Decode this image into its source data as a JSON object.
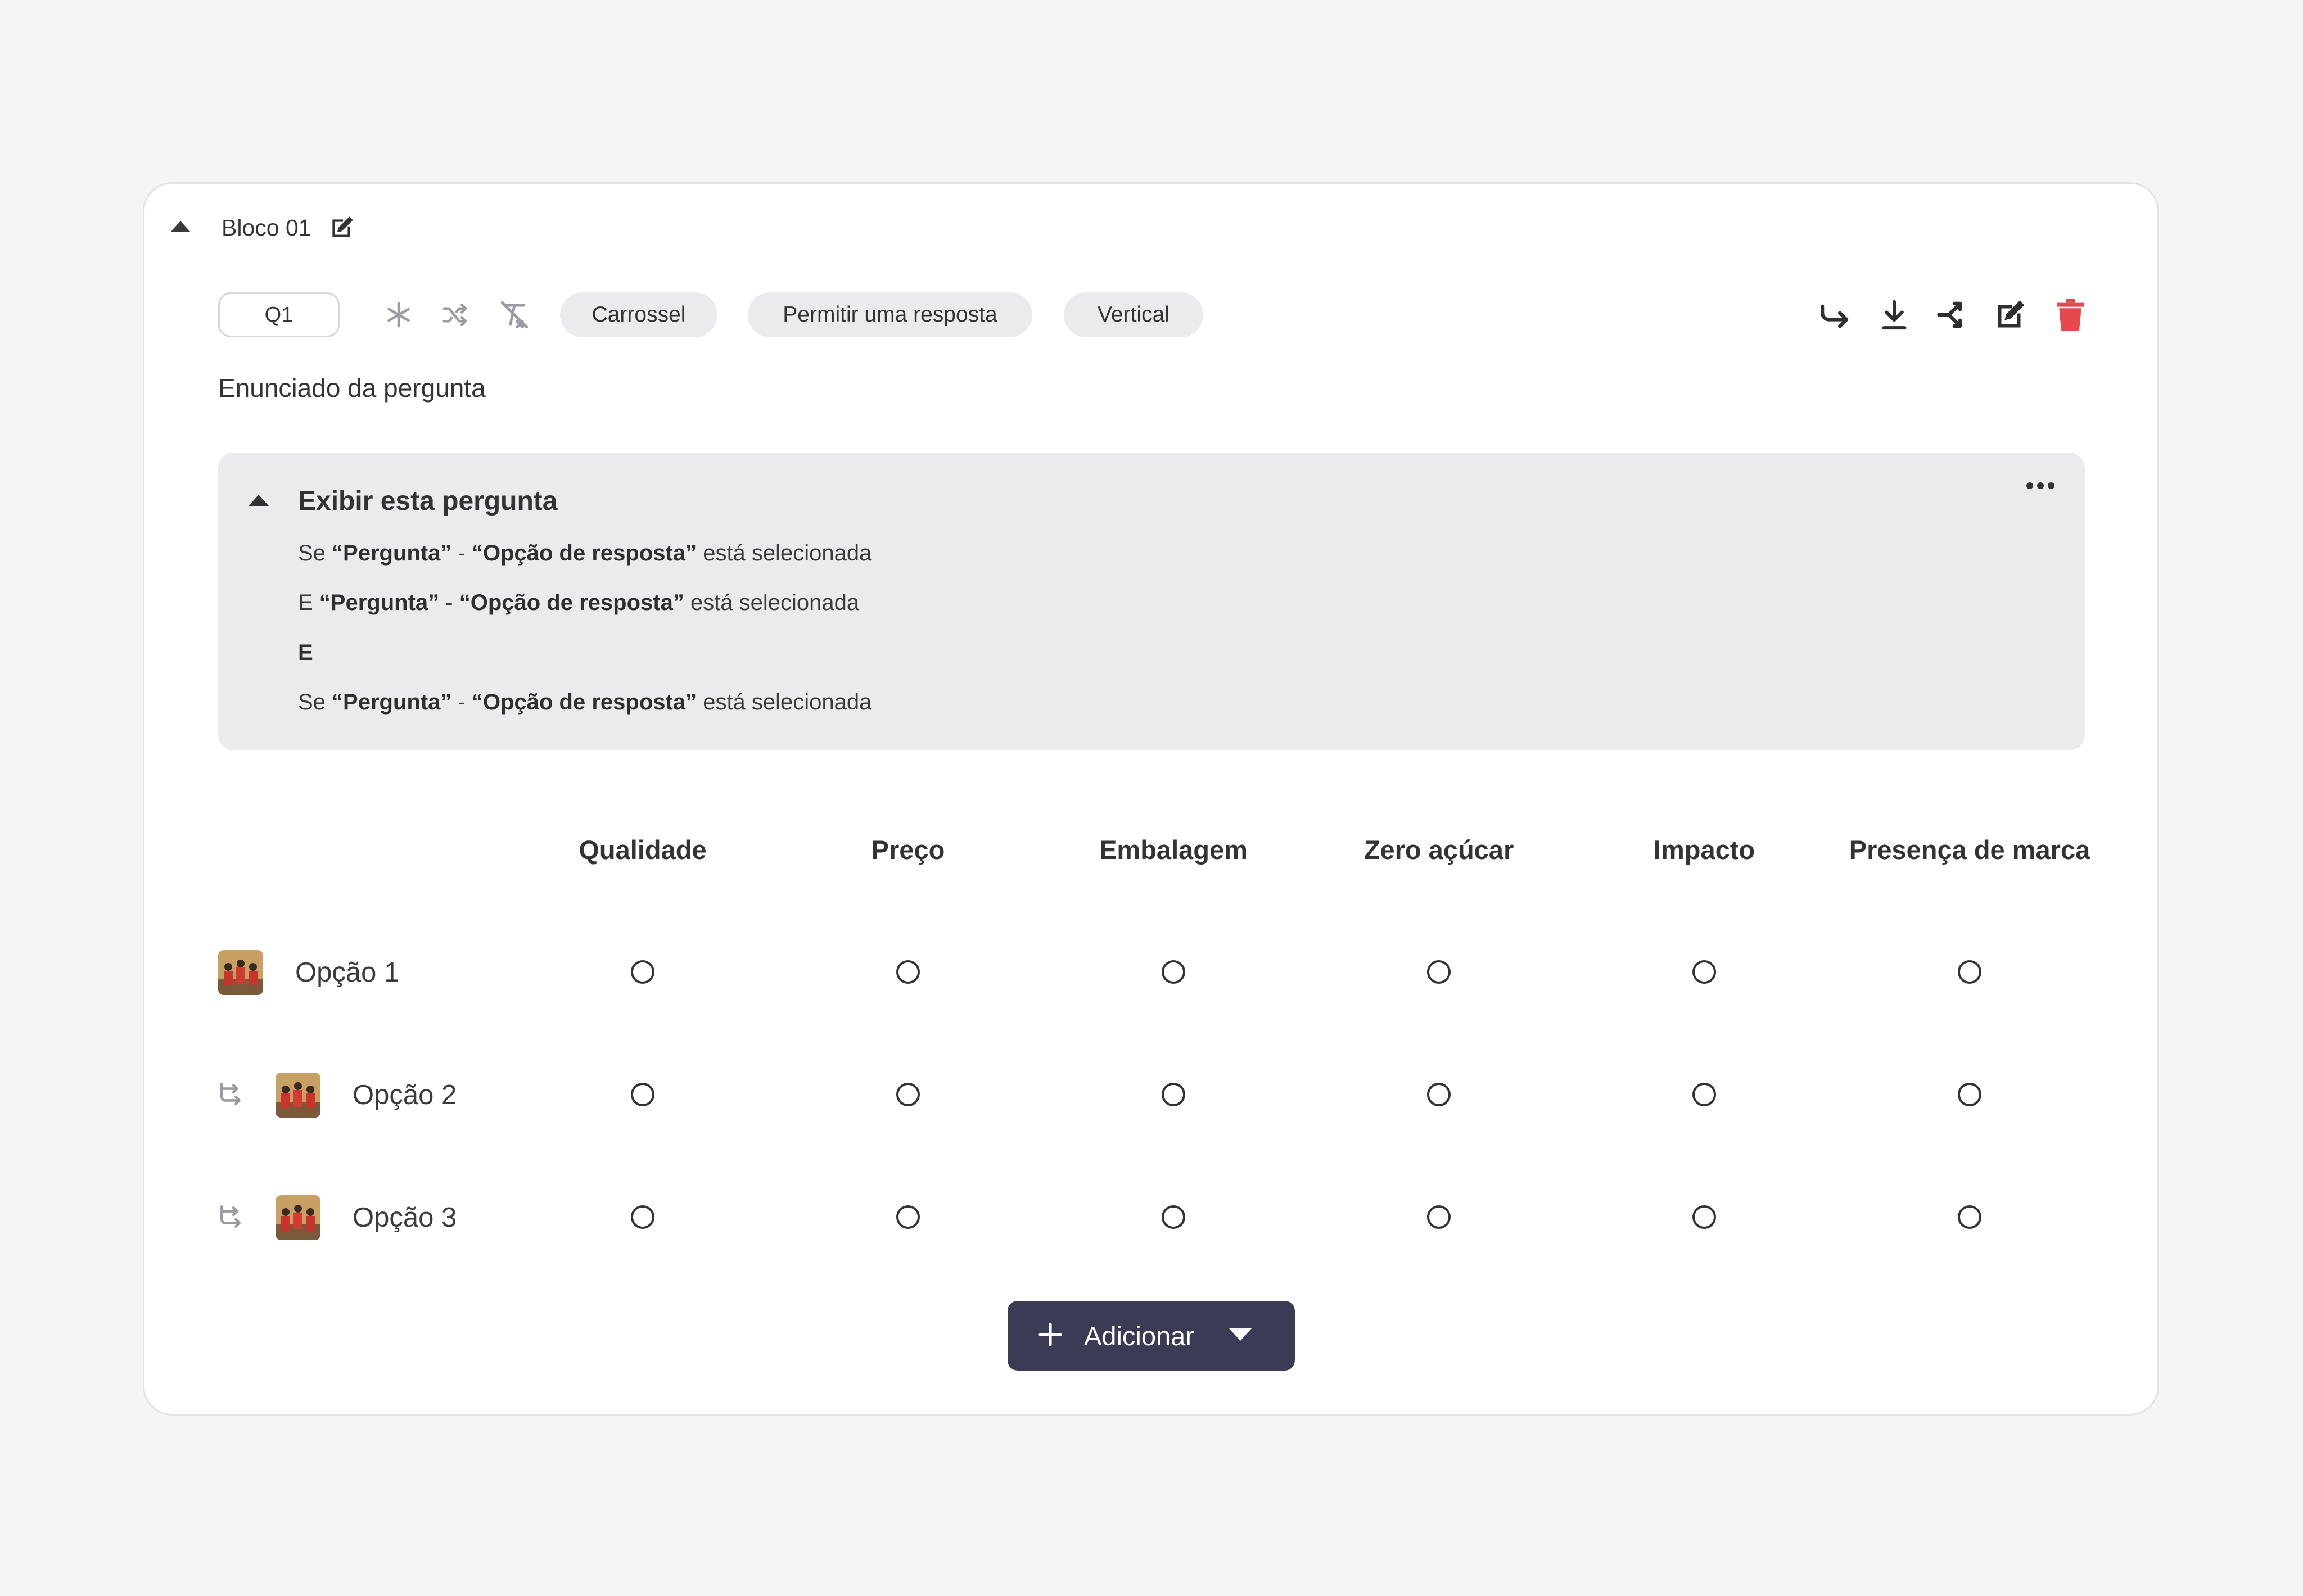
{
  "block": {
    "title": "Bloco 01",
    "icons": {
      "collapse": "caret-up-icon",
      "edit": "edit-icon"
    }
  },
  "question": {
    "id": "Q1",
    "toolbar_icons": [
      "required-asterisk-icon",
      "shuffle-icon",
      "clear-format-icon"
    ],
    "chips": [
      "Carrossel",
      "Permitir uma resposta",
      "Vertical"
    ],
    "action_icons": [
      "skip-logic-icon",
      "download-icon",
      "share-icon",
      "edit-icon",
      "trash-icon"
    ],
    "statement": "Enunciado da pergunta"
  },
  "display_logic": {
    "title": "Exibir esta pergunta",
    "more_icon": "more-dots-icon",
    "conditions": [
      {
        "prefix": "Se ",
        "question": "“Pergunta”",
        "sep": " - ",
        "option": "“Opção de resposta”",
        "suffix": " está selecionada"
      },
      {
        "prefix": "E ",
        "question": "“Pergunta”",
        "sep": " - ",
        "option": "“Opção de resposta”",
        "suffix": " está selecionada"
      },
      {
        "connector": "E"
      },
      {
        "prefix": "Se ",
        "question": "“Pergunta”",
        "sep": " - ",
        "option": "“Opção de resposta”",
        "suffix": " está selecionada"
      }
    ]
  },
  "grid": {
    "columns": [
      "Qualidade",
      "Preço",
      "Embalagem",
      "Zero açúcar",
      "Impacto",
      "Presença de marca"
    ],
    "rows": [
      {
        "label": "Opção 1",
        "linked": false
      },
      {
        "label": "Opção 2",
        "linked": true
      },
      {
        "label": "Opção 3",
        "linked": true
      }
    ]
  },
  "add_button": {
    "label": "Adicionar",
    "icons": [
      "plus-icon",
      "caret-down-icon"
    ]
  },
  "colors": {
    "danger": "#e5484d",
    "button_bg": "#3b3b55",
    "logic_bg": "#ebebed"
  }
}
